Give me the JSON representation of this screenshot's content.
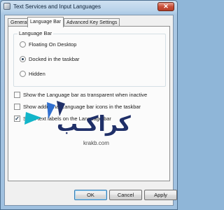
{
  "window": {
    "title": "Text Services and Input Languages",
    "close_glyph": "✕"
  },
  "tabs": [
    {
      "label": "General"
    },
    {
      "label": "Language Bar"
    },
    {
      "label": "Advanced Key Settings"
    }
  ],
  "language_bar_group": {
    "label": "Language Bar",
    "options": [
      {
        "label": "Floating On Desktop",
        "selected": false
      },
      {
        "label": "Docked in the taskbar",
        "selected": true
      },
      {
        "label": "Hidden",
        "selected": false
      }
    ]
  },
  "checkboxes": [
    {
      "label": "Show the Language bar as transparent when inactive",
      "checked": false
    },
    {
      "label": "Show additional Language bar icons in the taskbar",
      "checked": false
    },
    {
      "label": "Show text labels on the Language bar",
      "checked": true
    }
  ],
  "watermark": {
    "arabic_text": "كراكـب",
    "domain": "krakb.com"
  },
  "buttons": {
    "ok": "OK",
    "cancel": "Cancel",
    "apply": "Apply"
  },
  "colors": {
    "logo_blue": "#2f6fd0",
    "logo_teal": "#12b5c9",
    "logo_navy": "#1f2f68"
  }
}
